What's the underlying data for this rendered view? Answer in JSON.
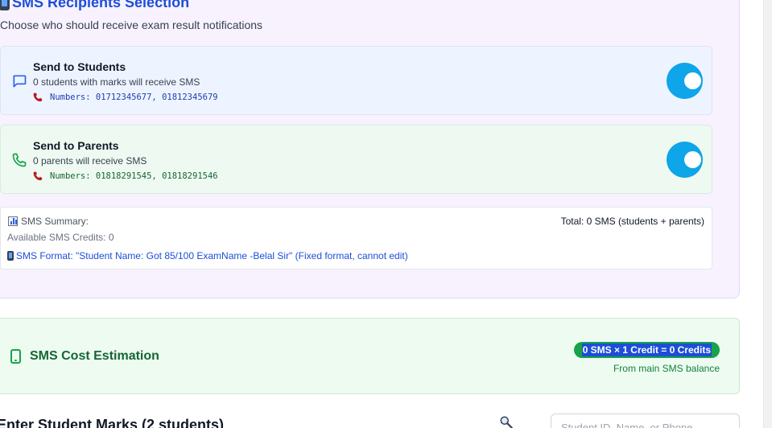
{
  "recipients": {
    "title": "SMS Recipients Selection",
    "subtitle": "Choose who should receive exam result notifications",
    "students": {
      "title": "Send to Students",
      "description": "0 students with marks will receive SMS",
      "numbers": "Numbers: 01712345677, 01812345679",
      "enabled": true,
      "icon": "message-icon"
    },
    "parents": {
      "title": "Send to Parents",
      "description": "0 parents will receive SMS",
      "numbers": "Numbers: 01818291545, 01818291546",
      "enabled": true,
      "icon": "phone-icon"
    },
    "summary": {
      "label": "SMS Summary:",
      "total": "Total: 0 SMS (students + parents)",
      "credits": "Available SMS Credits: 0",
      "format": "SMS Format: \"Student Name: Got 85/100 ExamName -Belal Sir\" (Fixed format, cannot edit)"
    }
  },
  "cost": {
    "title": "SMS Cost Estimation",
    "formula": "0 SMS × 1 Credit = 0 Credits",
    "note": "From main SMS balance"
  },
  "marks": {
    "title": "Enter Student Marks (2 students)",
    "search_placeholder": "Student ID, Name, or Phone"
  },
  "colors": {
    "toggle_on": "#0ea5e9",
    "students_bg": "#eef4ff",
    "parents_bg": "#eefaf1",
    "cost_badge": "#16a34a",
    "title_blue": "#1d4ed8"
  }
}
